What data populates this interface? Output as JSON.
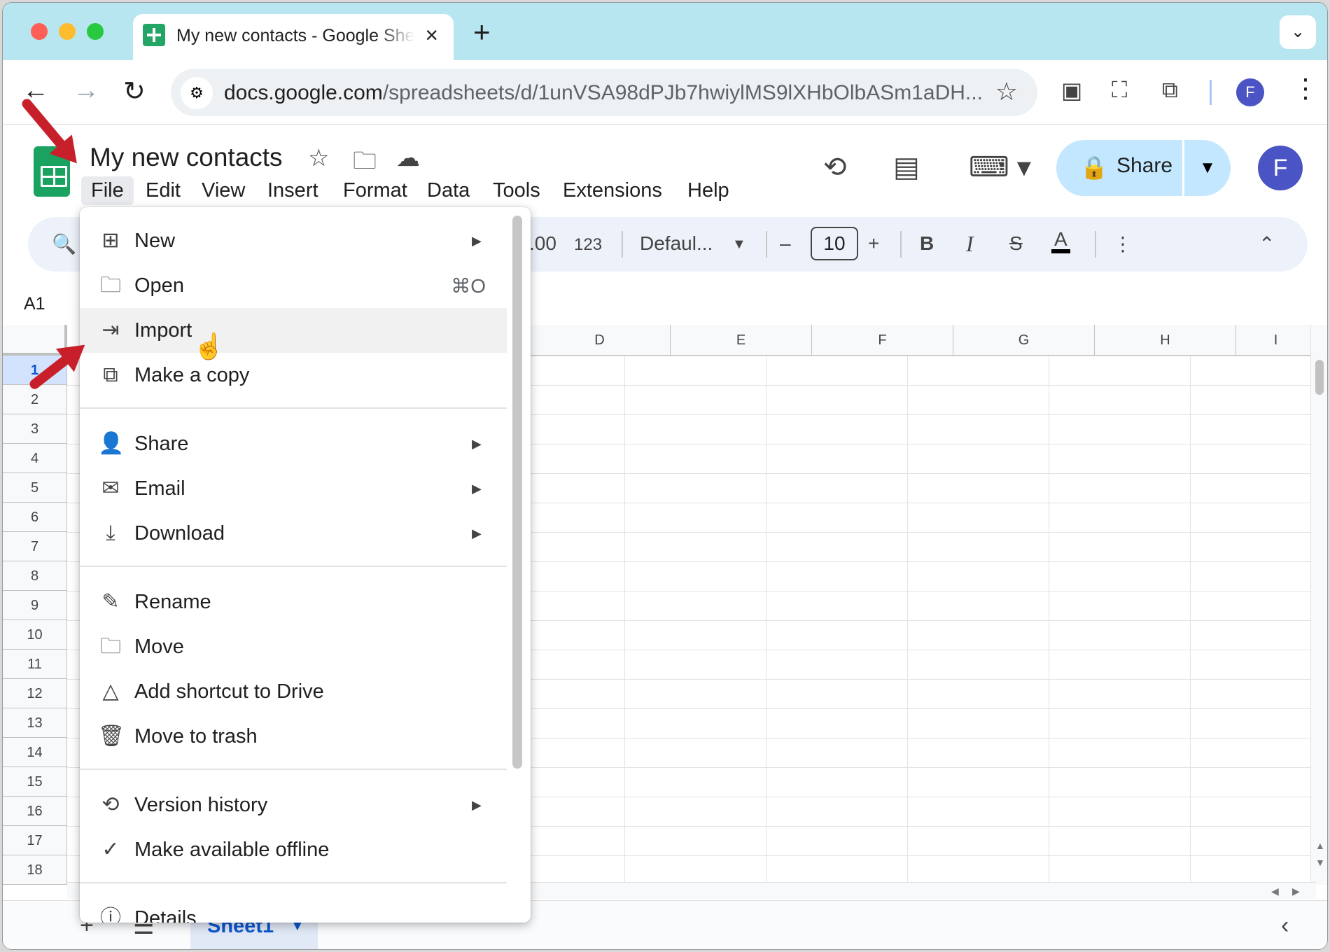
{
  "browser": {
    "tab_title": "My new contacts - Google Sheets",
    "url_host": "docs.google.com",
    "url_path": "/spreadsheets/d/1unVSA98dPJb7hwiylMS9lXHbOlbASm1aDH...",
    "profile_initial": "F"
  },
  "doc": {
    "title": "My new contacts",
    "menus": [
      "File",
      "Edit",
      "View",
      "Insert",
      "Format",
      "Data",
      "Tools",
      "Extensions",
      "Help"
    ],
    "share_label": "Share",
    "profile_initial": "F"
  },
  "toolbar": {
    "decimal_label": ".00",
    "number_format": "123",
    "font": "Defaul...",
    "font_size": "10",
    "minus": "–",
    "plus": "+",
    "bold": "B",
    "italic": "I",
    "strike": "S",
    "text_color": "A"
  },
  "grid": {
    "namebox": "A1",
    "columns": [
      "D",
      "E",
      "F",
      "G",
      "H",
      "I"
    ],
    "rows": [
      "1",
      "2",
      "3",
      "4",
      "5",
      "6",
      "7",
      "8",
      "9",
      "10",
      "11",
      "12",
      "13",
      "14",
      "15",
      "16",
      "17",
      "18"
    ]
  },
  "sheets": {
    "active": "Sheet1"
  },
  "file_menu": {
    "new": "New",
    "open": "Open",
    "open_shortcut": "⌘O",
    "import": "Import",
    "make_copy": "Make a copy",
    "share": "Share",
    "email": "Email",
    "download": "Download",
    "rename": "Rename",
    "move": "Move",
    "add_shortcut": "Add shortcut to Drive",
    "trash": "Move to trash",
    "version_history": "Version history",
    "offline": "Make available offline",
    "details": "Details"
  },
  "colors": {
    "tabstrip": "#b8e6f0",
    "share_button": "#c2e7ff",
    "accent": "#0b57d0",
    "annotation_arrow": "#c8202a"
  }
}
